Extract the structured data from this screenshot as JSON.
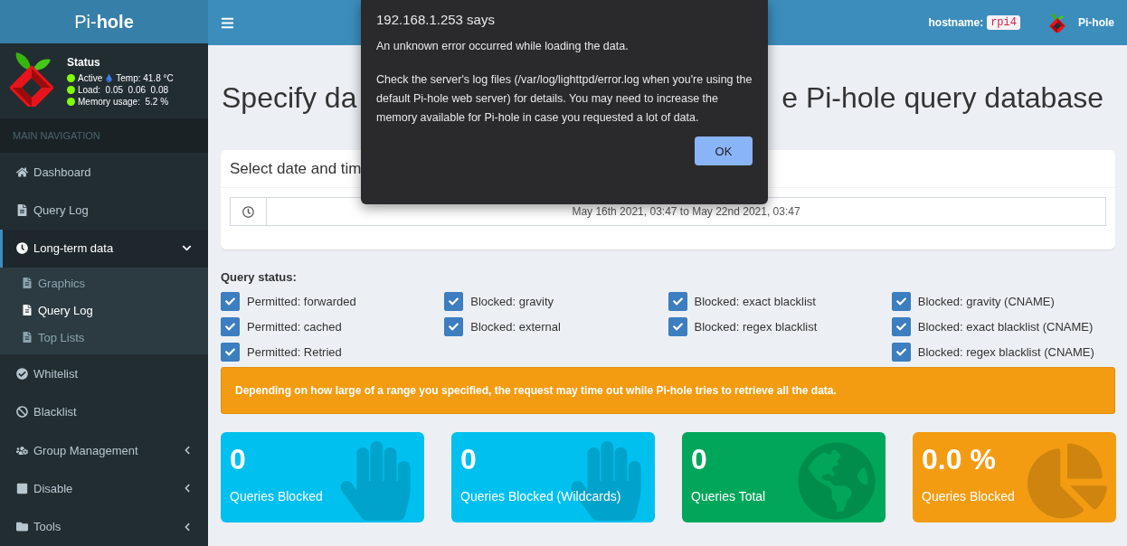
{
  "brand": "Pi-**hole**",
  "status": {
    "title": "Status",
    "lines": [
      {
        "label": "Active",
        "extra": "Temp: 41.8 °C"
      },
      {
        "label": "Load:  0.05  0.06  0.08"
      },
      {
        "label": "Memory usage:  5.2 %"
      }
    ]
  },
  "nav_header": "MAIN NAVIGATION",
  "sidebar": {
    "items": [
      {
        "label": "Dashboard",
        "selected": false
      },
      {
        "label": "Query Log",
        "selected": false
      },
      {
        "label": "Long-term data",
        "selected": true,
        "expanded": true,
        "children": [
          {
            "label": "Graphics",
            "selected": false
          },
          {
            "label": "Query Log",
            "selected": true
          },
          {
            "label": "Top Lists",
            "selected": false
          }
        ]
      },
      {
        "label": "Whitelist",
        "selected": false
      },
      {
        "label": "Blacklist",
        "selected": false
      },
      {
        "label": "Group Management",
        "selected": false,
        "expanded": false
      },
      {
        "label": "Disable",
        "selected": false,
        "expanded": false
      },
      {
        "label": "Tools",
        "selected": false,
        "expanded": false
      }
    ]
  },
  "topbar": {
    "hostname_label": "hostname:",
    "hostname": "rpi4",
    "user": "Pi-hole"
  },
  "title_parts": [
    "Specify da",
    "e Pi-hole query database"
  ],
  "date_card": {
    "header": "Select date and tim",
    "range": "May 16th 2021, 03:47 to May 22nd 2021, 03:47"
  },
  "query_status": {
    "label": "Query status:",
    "columns": [
      {
        "items": [
          {
            "label": "Permitted: forwarded",
            "checked": true
          },
          {
            "label": "Permitted: cached",
            "checked": true
          },
          {
            "label": "Permitted: Retried",
            "checked": true
          }
        ]
      },
      {
        "items": [
          {
            "label": "Blocked: gravity",
            "checked": true
          },
          {
            "label": "Blocked: external",
            "checked": true
          }
        ]
      },
      {
        "items": [
          {
            "label": "Blocked: exact blacklist",
            "checked": true
          },
          {
            "label": "Blocked: regex blacklist",
            "checked": true
          }
        ]
      },
      {
        "items": [
          {
            "label": "Blocked: gravity (CNAME)",
            "checked": true
          },
          {
            "label": "Blocked: exact blacklist (CNAME)",
            "checked": true
          },
          {
            "label": "Blocked: regex blacklist (CNAME)",
            "checked": true
          }
        ]
      }
    ]
  },
  "warning": "Depending on how large of a range you specified, the request may time out while Pi-hole tries to retrieve all the data.",
  "stats": [
    {
      "value": "0",
      "label": "Queries Blocked",
      "color": "#00c0ef"
    },
    {
      "value": "0",
      "label": "Queries Blocked (Wildcards)",
      "color": "#00c0ef"
    },
    {
      "value": "0",
      "label": "Queries Total",
      "color": "#00a65a"
    },
    {
      "value": "0.0 %",
      "label": "Queries Blocked",
      "color": "#f39c12"
    }
  ],
  "dialog": {
    "title": "192.168.1.253 says",
    "messages": [
      "An unknown error occurred while loading the data.",
      "Check the server's log files (/var/log/lighttpd/error.log when you're using the default Pi-hole web server) for details. You may need to increase the memory available for Pi-hole in case you requested a lot of data."
    ],
    "button": "OK"
  }
}
